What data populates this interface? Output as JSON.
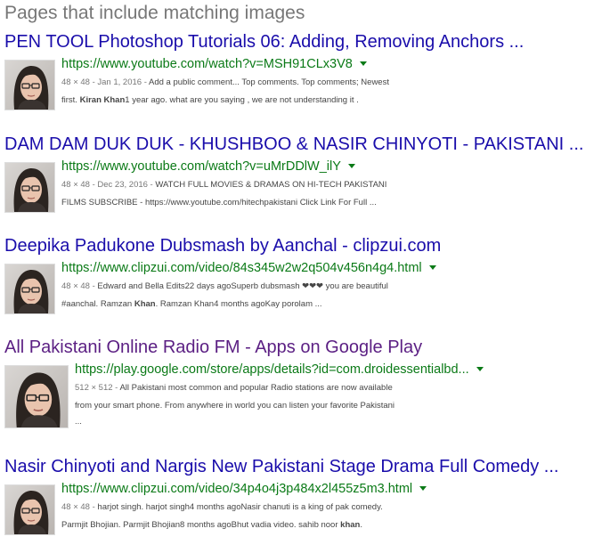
{
  "section_title": "Pages that include matching images",
  "results": [
    {
      "title": "PEN TOOL Photoshop Tutorials 06: Adding, Removing Anchors ...",
      "url": "https://www.youtube.com/watch?v=MSH91CLx3V8",
      "meta": "48 × 48 - Jan 1, 2016 - ",
      "snippet1_rest": "Add a public comment... Top comments. Top comments; Newest",
      "snippet2_pre": "first. ",
      "snippet2_bold": "Kiran Khan",
      "snippet2_post": "1 year ago. what are you saying , we are not understanding it ."
    },
    {
      "title": "DAM DAM DUK DUK - KHUSHBOO & NASIR CHINYOTI - PAKISTANI ...",
      "url": "https://www.youtube.com/watch?v=uMrDDlW_ilY",
      "meta": "48 × 48 - Dec 23, 2016 - ",
      "snippet1_rest": "WATCH FULL MOVIES & DRAMAS ON HI-TECH PAKISTANI",
      "snippet2_pre": "FILMS SUBSCRIBE - https://www.youtube.com/hitechpakistani Click Link For Full ...",
      "snippet2_bold": "",
      "snippet2_post": ""
    },
    {
      "title": "Deepika Padukone Dubsmash by Aanchal - clipzui.com",
      "url": "https://www.clipzui.com/video/84s345w2w2q504v456n4g4.html",
      "meta": "48 × 48 - ",
      "snippet1_rest": "Edward and Bella Edits22 days agoSuperb dubsmash ❤❤❤ you are beautiful",
      "snippet2_pre": "#aanchal. Ramzan ",
      "snippet2_bold": "Khan",
      "snippet2_post": ". Ramzan Khan4 months agoKay porolam ..."
    },
    {
      "title": "All Pakistani Online Radio FM - Apps on Google Play",
      "url": "https://play.google.com/store/apps/details?id=com.droidessentialbd...",
      "meta": "512 × 512 - ",
      "snippet1_rest": "All Pakistani most common and popular Radio stations are now available",
      "snippet2_pre": "from your smart phone. From anywhere in world you can listen your favorite Pakistani",
      "snippet2_bold": "",
      "snippet2_post": "",
      "snippet3": "..."
    },
    {
      "title": "Nasir Chinyoti and Nargis New Pakistani Stage Drama Full Comedy ...",
      "url": "https://www.clipzui.com/video/34p4o4j3p484x2l455z5m3.html",
      "meta": "48 × 48 - ",
      "snippet1_rest": "harjot singh. harjot singh4 months agoNasir chanuti is a king of pak comedy.",
      "snippet2_pre": "Parmjit Bhojian. Parmjit Bhojian8 months agoBhut vadia video. sahib noor ",
      "snippet2_bold": "khan",
      "snippet2_post": "."
    }
  ],
  "icons": {
    "thumbnail": "person-photo-icon",
    "dropdown": "caret-down-icon"
  },
  "colors": {
    "title": "#1a0dab",
    "visited": "#5b1f83",
    "url": "#0b7a17",
    "meta": "#777777"
  }
}
